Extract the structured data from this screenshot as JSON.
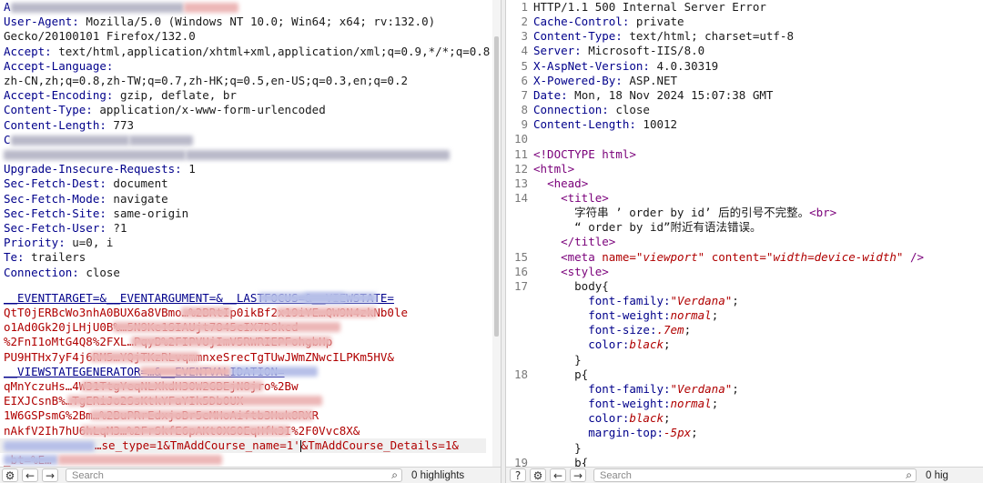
{
  "request": {
    "lines": [
      {
        "k": "A",
        "v": "",
        "obscured": true
      },
      {
        "k": "User-Agent",
        "v": "Mozilla/5.0 (Windows NT 10.0; Win64; x64; rv:132.0)"
      },
      {
        "k": "",
        "v": "Gecko/20100101 Firefox/132.0"
      },
      {
        "k": "Accept",
        "v": "text/html,application/xhtml+xml,application/xml;q=0.9,*/*;q=0.8"
      },
      {
        "k": "Accept-Language",
        "v": ""
      },
      {
        "k": "",
        "v": "zh-CN,zh;q=0.8,zh-TW;q=0.7,zh-HK;q=0.5,en-US;q=0.3,en;q=0.2"
      },
      {
        "k": "Accept-Encoding",
        "v": "gzip, deflate, br"
      },
      {
        "k": "Content-Type",
        "v": "application/x-www-form-urlencoded"
      },
      {
        "k": "Content-Length",
        "v": "773"
      },
      {
        "k": "C",
        "v": "",
        "obscured": true
      },
      {
        "k": "",
        "v": "",
        "obscured": true
      },
      {
        "k": "Upgrade-Insecure-Requests",
        "v": "1"
      },
      {
        "k": "Sec-Fetch-Dest",
        "v": "document"
      },
      {
        "k": "Sec-Fetch-Mode",
        "v": "navigate"
      },
      {
        "k": "Sec-Fetch-Site",
        "v": "same-origin"
      },
      {
        "k": "Sec-Fetch-User",
        "v": "?1"
      },
      {
        "k": "Priority",
        "v": "u=0, i"
      },
      {
        "k": "Te",
        "v": "trailers"
      },
      {
        "k": "Connection",
        "v": "close"
      }
    ],
    "body_lines": [
      "__EVENTTARGET=&__EVENTARGUMENT=&__LASTFOCUS=&__VIEWSTATE=",
      "QtT0jERBcWo3nhA0BUX6a8VBmo…%2BRtIp0ikBf2x19iYE…QW9N4zkNb0le",
      "o1Ad0Gk20jLHjU0B%…5N9Ke1SIAUjt7845cIX7D8kcd",
      "%2FnI1oMtG4Q8%2FXL…PqyB%2FIPVUjImV5RWRIEPFohgbHp",
      "PU9HTHx7yF4j6RM5…YQjTKzRLvqmmnxeSrecTgTUwJWmZNwcILPKm5HV&",
      "__VIEWSTATEGENERATOR=…&__EVENTVALIDATION=",
      "qMnYczuHs…4W31TtgYeqNLXkdH30W2GBEjN8jro%2Bw",
      "EIXJCsnB%…TgERiJo2SsKtkYFaYIk5Db0UX",
      "1W6GSPsmG%2Bm…%2BuPRrEdxjoBr5eMHoAiftb3Huk8RXR",
      "nAkfV2Ih7hU6hLqM3…%2FrSkfE6pAKt0XS0EqHfk3I%2F0Vvc8X&",
      "",
      "_bt=%E…"
    ],
    "active_line": {
      "pre": "…se_type=1&TmAddCourse_name=1'",
      "post": "&TmAddCourse_Details=1&"
    },
    "search": {
      "placeholder": "Search",
      "highlights": "0 highlights"
    }
  },
  "response": {
    "lines": [
      {
        "n": "1",
        "text": "HTTP/1.1 500 Internal Server Error"
      },
      {
        "n": "2",
        "k": "Cache-Control",
        "v": "private"
      },
      {
        "n": "3",
        "k": "Content-Type",
        "v": "text/html; charset=utf-8"
      },
      {
        "n": "4",
        "k": "Server",
        "v": "Microsoft-IIS/8.0"
      },
      {
        "n": "5",
        "k": "X-AspNet-Version",
        "v": "4.0.30319"
      },
      {
        "n": "6",
        "k": "X-Powered-By",
        "v": "ASP.NET"
      },
      {
        "n": "7",
        "k": "Date",
        "v": "Mon, 18 Nov 2024 15:07:38 GMT"
      },
      {
        "n": "8",
        "k": "Connection",
        "v": "close"
      },
      {
        "n": "9",
        "k": "Content-Length",
        "v": "10012"
      },
      {
        "n": "10",
        "text": ""
      },
      {
        "n": "11",
        "tag": "<!DOCTYPE html>"
      },
      {
        "n": "12",
        "tag": "<html>"
      },
      {
        "n": "13",
        "tag": "<head>",
        "indent": 1
      },
      {
        "n": "14",
        "tag": "<title>",
        "indent": 2
      },
      {
        "n": "",
        "text": "字符串 ’ order by id’ 后的引号不完整。",
        "tag2": "<br>",
        "indent": 3
      },
      {
        "n": "",
        "text": "“ order by id”附近有语法错误。",
        "indent": 3
      },
      {
        "n": "",
        "tag": "</title>",
        "indent": 2
      },
      {
        "n": "15",
        "meta": true,
        "indent": 2
      },
      {
        "n": "16",
        "tag": "<style>",
        "indent": 2
      },
      {
        "n": "17",
        "text": "body{",
        "indent": 3
      },
      {
        "n": "",
        "ck": "font-family",
        "cv": "\"Verdana\"",
        "indent": 4
      },
      {
        "n": "",
        "ck": "font-weight",
        "cv": "normal",
        "indent": 4
      },
      {
        "n": "",
        "ck": "font-size",
        "cv": ".7em",
        "indent": 4
      },
      {
        "n": "",
        "ck": "color",
        "cv": "black",
        "indent": 4
      },
      {
        "n": "",
        "text": "}",
        "indent": 3
      },
      {
        "n": "18",
        "text": "p{",
        "indent": 3
      },
      {
        "n": "",
        "ck": "font-family",
        "cv": "\"Verdana\"",
        "indent": 4
      },
      {
        "n": "",
        "ck": "font-weight",
        "cv": "normal",
        "indent": 4
      },
      {
        "n": "",
        "ck": "color",
        "cv": "black",
        "indent": 4
      },
      {
        "n": "",
        "ck": "margin-top",
        "cv": "-5px",
        "indent": 4
      },
      {
        "n": "",
        "text": "}",
        "indent": 3
      },
      {
        "n": "19",
        "text": "b{",
        "indent": 3
      }
    ],
    "meta": {
      "tag": "<meta",
      "name_attr": "name",
      "name_val": "\"viewport\"",
      "content_attr": "content",
      "content_val": "\"width=device-width\"",
      "close": "/>"
    },
    "search": {
      "placeholder": "Search",
      "highlights": "0 hig"
    }
  },
  "icons": {
    "help": "help-icon",
    "settings": "gear-icon",
    "back": "arrow-left-icon",
    "forward": "arrow-right-icon",
    "search": "magnifier-icon"
  }
}
